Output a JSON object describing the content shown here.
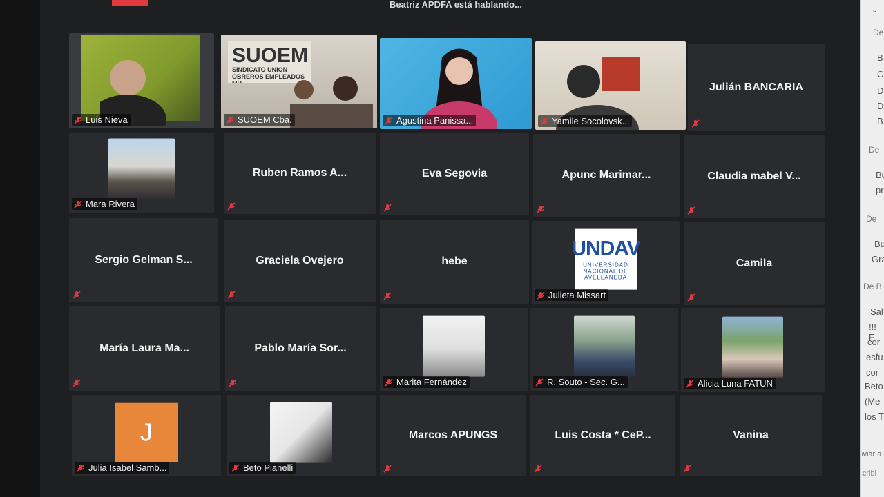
{
  "header": {
    "speaking_status": "Beatriz APDFA está hablando..."
  },
  "participants": [
    {
      "name": "Luis Nieva",
      "video": true
    },
    {
      "name": "SUOEM Cba.",
      "video": true,
      "sign_title": "SUOEM",
      "sign_sub": "SINDICATO UNION OBREROS EMPLEADOS MU"
    },
    {
      "name": "Agustina Panissa...",
      "video": true
    },
    {
      "name": "Yamile Socolovsk...",
      "video": true
    },
    {
      "name": "Julián BANCARIA",
      "video": false
    },
    {
      "name": "Mara Rivera",
      "photo": true
    },
    {
      "name": "Ruben Ramos A...",
      "video": false
    },
    {
      "name": "Eva Segovia",
      "video": false
    },
    {
      "name": "Apunc Marimar...",
      "video": false
    },
    {
      "name": "Claudia mabel V...",
      "video": false
    },
    {
      "name": "Sergio Gelman S...",
      "video": false
    },
    {
      "name": "Graciela Ovejero",
      "video": false
    },
    {
      "name": "hebe",
      "video": false
    },
    {
      "name": "Julieta Missart",
      "photo": true,
      "logo_title": "UNDAV",
      "logo_sub": "UNIVERSIDAD NACIONAL DE AVELLANEDA"
    },
    {
      "name": "Camila",
      "video": false
    },
    {
      "name": "María Laura Ma...",
      "video": false
    },
    {
      "name": "Pablo María Sor...",
      "video": false
    },
    {
      "name": "Marita Fernández",
      "photo": true
    },
    {
      "name": "R. Souto - Sec. G...",
      "photo": true
    },
    {
      "name": "Alicia Luna FATUN",
      "photo": true
    },
    {
      "name": "Julia Isabel Samb...",
      "photo": true,
      "avatar_letter": "J"
    },
    {
      "name": "Beto Pianelli",
      "photo": true
    },
    {
      "name": "Marcos APUNGS",
      "video": false
    },
    {
      "name": "Luis Costa * CeP...",
      "video": false
    },
    {
      "name": "Vanina",
      "video": false
    }
  ],
  "chat_panel": {
    "items": [
      "De",
      "B",
      "C",
      "D",
      "D",
      "B",
      "De",
      "Bu",
      "pr",
      "De",
      "Bu",
      "Gra",
      "De B",
      "Sal",
      "!!! F",
      "cor",
      "esfu",
      "cor",
      "Beto",
      "(Me",
      "los T",
      "Enviar a",
      "Escribi"
    ]
  },
  "colors": {
    "accent": "#e0393e",
    "tile": "#2a2b2e",
    "mic_muted": "#e0393e"
  }
}
